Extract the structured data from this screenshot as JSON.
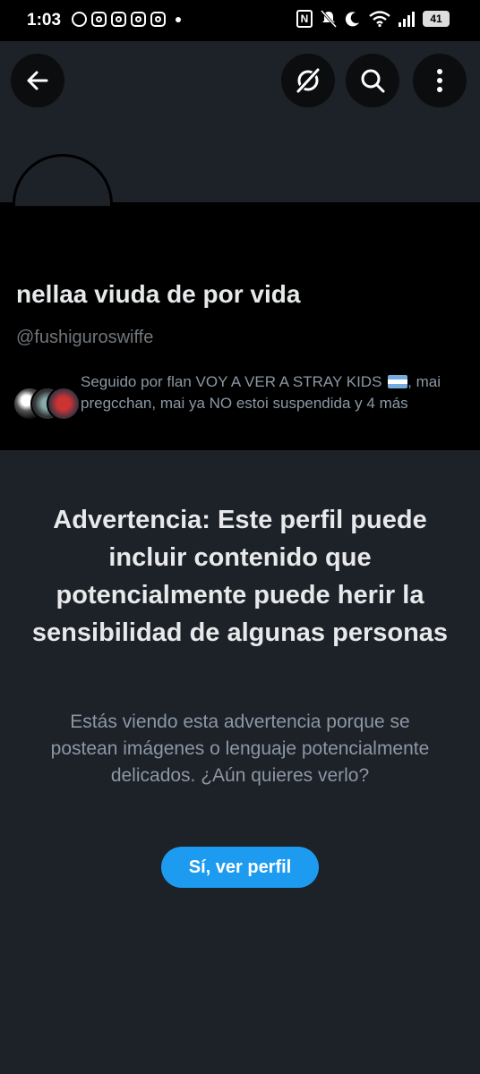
{
  "status_bar": {
    "time": "1:03",
    "battery": "41"
  },
  "profile": {
    "name": "nellaa viuda de por vida",
    "handle": "@fushiguroswiffe",
    "followed_by": "Seguido por flan VOY A VER A STRAY KIDS",
    "followed_by_rest": ", mai pregcchan, mai ya NO estoi suspendida y 4 más"
  },
  "warning": {
    "title": "Advertencia: Este perfil puede incluir contenido que potencialmente puede herir la sensibilidad de algunas personas",
    "body": "Estás viendo esta advertencia porque se postean imágenes o lenguaje potencialmente delicados. ¿Aún quieres verlo?",
    "button_label": "Sí, ver perfil"
  },
  "icons": {
    "back": "arrow-left-icon",
    "grok": "grok-icon",
    "search": "search-icon",
    "more": "more-vertical-icon"
  },
  "colors": {
    "accent": "#1d9bf0",
    "background": "#1d2128",
    "panel": "#000000",
    "secondary_text": "#8b98a5"
  }
}
